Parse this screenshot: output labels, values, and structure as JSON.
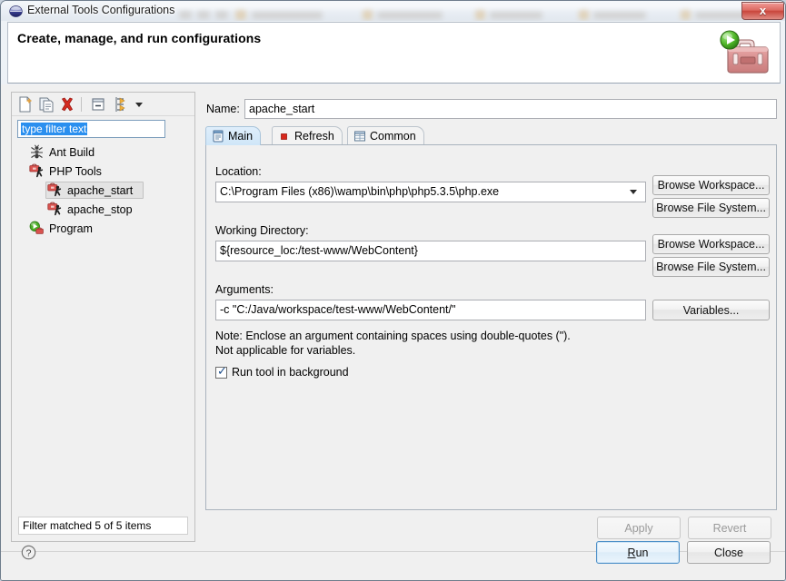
{
  "window": {
    "title": "External Tools Configurations",
    "title_icon": "eclipse-sphere-icon",
    "close_label": "x"
  },
  "banner": {
    "title": "Create, manage, and run configurations",
    "icon": "toolbox-with-run-icon"
  },
  "tree_toolbar": {
    "buttons": [
      {
        "name": "new-configuration-button",
        "icon": "new-document-icon",
        "tooltip": "New launch configuration"
      },
      {
        "name": "duplicate-configuration-button",
        "icon": "copy-document-icon",
        "tooltip": "Duplicate"
      },
      {
        "name": "delete-configuration-button",
        "icon": "red-x-delete-icon",
        "tooltip": "Delete"
      },
      {
        "name": "collapse-all-button",
        "icon": "collapse-all-icon",
        "tooltip": "Collapse All"
      },
      {
        "name": "filter-button",
        "icon": "filter-arrows-icon",
        "tooltip": "Filter"
      },
      {
        "name": "filter-dropdown-button",
        "icon": "chevron-down-icon",
        "tooltip": "Menu"
      }
    ]
  },
  "filter": {
    "value": "type filter text",
    "status": "Filter matched 5 of 5 items"
  },
  "tree": {
    "items": [
      {
        "label": "Ant Build",
        "icon": "ant-build-icon",
        "indent": 18,
        "selected": false
      },
      {
        "label": "PHP Tools",
        "icon": "php-tools-icon",
        "indent": 18,
        "selected": false
      },
      {
        "label": "apache_start",
        "icon": "php-tools-icon",
        "indent": 38,
        "selected": true
      },
      {
        "label": "apache_stop",
        "icon": "php-tools-icon",
        "indent": 38,
        "selected": false
      },
      {
        "label": "Program",
        "icon": "program-run-icon",
        "indent": 18,
        "selected": false
      }
    ]
  },
  "name_field": {
    "label": "Name:",
    "value": "apache_start"
  },
  "tabs": [
    {
      "label": "Main",
      "icon": "main-document-icon",
      "active": true
    },
    {
      "label": "Refresh",
      "icon": "red-square-icon",
      "active": false
    },
    {
      "label": "Common",
      "icon": "grid-table-icon",
      "active": false
    }
  ],
  "main_tab": {
    "location": {
      "label": "Location:",
      "value": "C:\\Program Files (x86)\\wamp\\bin\\php\\php5.3.5\\php.exe",
      "browse_workspace": "Browse Workspace...",
      "browse_filesystem": "Browse File System..."
    },
    "working_directory": {
      "label": "Working Directory:",
      "value": "${resource_loc:/test-www/WebContent}",
      "browse_workspace": "Browse Workspace...",
      "browse_filesystem": "Browse File System..."
    },
    "arguments": {
      "label": "Arguments:",
      "value": "-c \"C:/Java/workspace/test-www/WebContent/\"",
      "variables_button": "Variables..."
    },
    "note_line1": "Note: Enclose an argument containing spaces using double-quotes (\").",
    "note_line2": "Not applicable for variables.",
    "run_in_background": {
      "label": "Run tool in background",
      "checked": true,
      "mark": "✓"
    }
  },
  "actions": {
    "apply": "Apply",
    "revert": "Revert",
    "run": "Run",
    "run_mnemonic": "R",
    "run_rest": "un",
    "close": "Close",
    "help_icon": "question-mark-help-icon"
  },
  "colors": {
    "accent_blue": "#2a8fef",
    "delete_red": "#cc2222",
    "tab_active": "#cfe6f8",
    "default_button_border": "#4d90c8"
  }
}
